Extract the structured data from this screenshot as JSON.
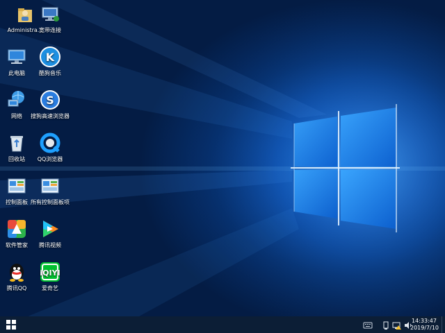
{
  "desktop": {
    "icons": [
      {
        "label": "Administra...",
        "icon": "user-folder-icon"
      },
      {
        "label": "宽带连接",
        "icon": "broadband-connection-icon"
      },
      {
        "label": "此电脑",
        "icon": "this-pc-icon"
      },
      {
        "label": "酷狗音乐",
        "icon": "kugou-music-icon"
      },
      {
        "label": "网络",
        "icon": "network-icon"
      },
      {
        "label": "搜狗高速浏览器",
        "icon": "sogou-browser-icon"
      },
      {
        "label": "回收站",
        "icon": "recycle-bin-icon"
      },
      {
        "label": "QQ浏览器",
        "icon": "qq-browser-icon"
      },
      {
        "label": "控制面板",
        "icon": "control-panel-icon"
      },
      {
        "label": "所有控制面板项",
        "icon": "all-control-panel-items-icon"
      },
      {
        "label": "软件管家",
        "icon": "software-manager-icon"
      },
      {
        "label": "腾讯视频",
        "icon": "tencent-video-icon"
      },
      {
        "label": "腾讯QQ",
        "icon": "tencent-qq-icon"
      },
      {
        "label": "爱奇艺",
        "icon": "iqiyi-icon"
      }
    ]
  },
  "taskbar": {
    "start_icon": "windows-logo-icon",
    "tray": [
      "keyboard-icon",
      "usb-device-icon",
      "network-status-icon",
      "volume-icon"
    ],
    "clock_time": "14:33:47",
    "clock_date": "2019/7/10"
  }
}
